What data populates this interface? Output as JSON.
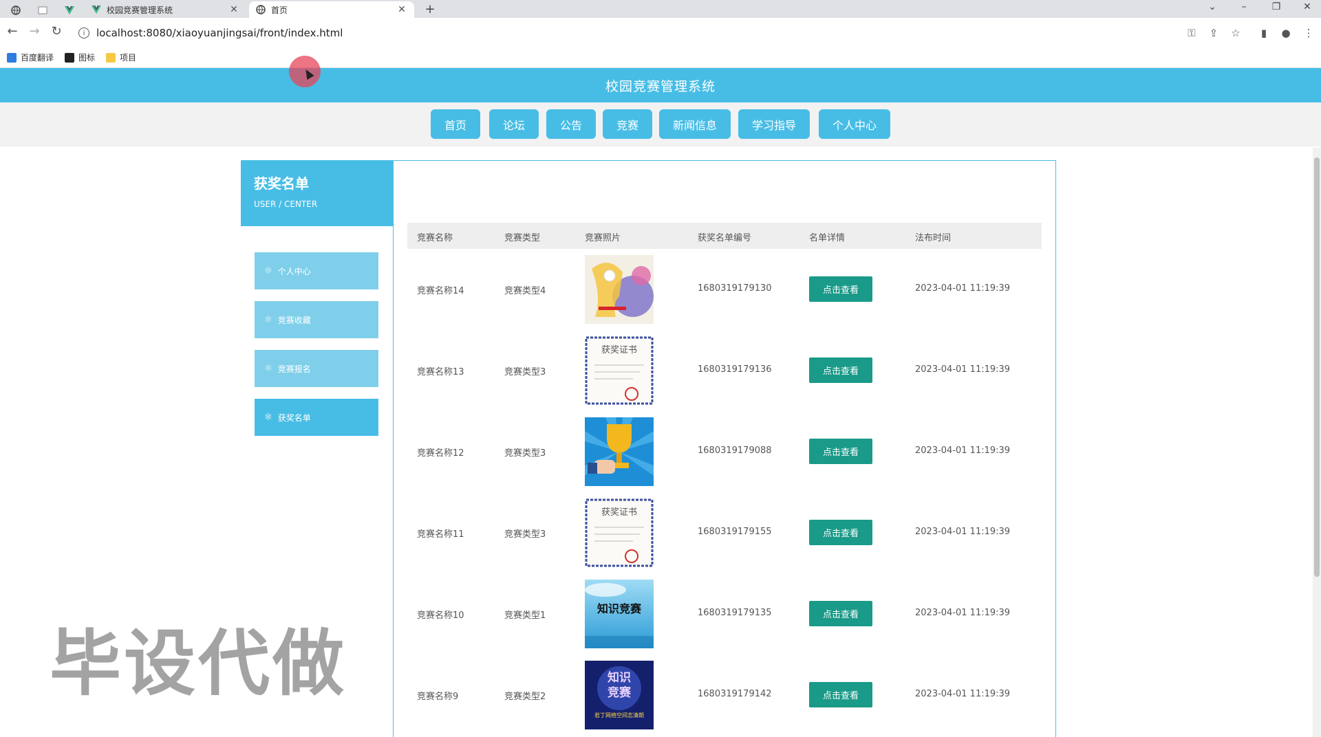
{
  "browser": {
    "tabs": [
      {
        "title": "校园竞赛管理系统",
        "active": false
      },
      {
        "title": "首页",
        "active": true
      }
    ],
    "address": "localhost:8080/xiaoyuanjingsai/front/index.html",
    "bookmarks": [
      "百度翻译",
      "图标",
      "项目"
    ]
  },
  "site": {
    "title": "校园竞赛管理系统",
    "nav": [
      "首页",
      "论坛",
      "公告",
      "竞赛",
      "新闻信息",
      "学习指导",
      "个人中心"
    ]
  },
  "sidebar": {
    "title": "获奖名单",
    "subtitle": "USER / CENTER",
    "items": [
      {
        "label": "个人中心",
        "active": false
      },
      {
        "label": "竞赛收藏",
        "active": false
      },
      {
        "label": "竞赛报名",
        "active": false
      },
      {
        "label": "获奖名单",
        "active": true
      }
    ]
  },
  "table": {
    "headers": [
      "竞赛名称",
      "竞赛类型",
      "竞赛照片",
      "获奖名单编号",
      "名单详情",
      "法布时间"
    ],
    "button_label": "点击查看",
    "rows": [
      {
        "name": "竞赛名称14",
        "type": "竞赛类型4",
        "photo": "abstract-face-image",
        "number": "1680319179130",
        "time": "2023-04-01 11:19:39"
      },
      {
        "name": "竞赛名称13",
        "type": "竞赛类型3",
        "photo": "certificate-image",
        "number": "1680319179136",
        "time": "2023-04-01 11:19:39"
      },
      {
        "name": "竞赛名称12",
        "type": "竞赛类型3",
        "photo": "trophy-image",
        "number": "1680319179088",
        "time": "2023-04-01 11:19:39"
      },
      {
        "name": "竞赛名称11",
        "type": "竞赛类型3",
        "photo": "certificate-image",
        "number": "1680319179155",
        "time": "2023-04-01 11:19:39"
      },
      {
        "name": "竞赛名称10",
        "type": "竞赛类型1",
        "photo": "knowledge-contest-sky-image",
        "number": "1680319179135",
        "time": "2023-04-01 11:19:39"
      },
      {
        "name": "竞赛名称9",
        "type": "竞赛类型2",
        "photo": "knowledge-contest-poster-image",
        "number": "1680319179142",
        "time": "2023-04-01 11:19:39"
      }
    ],
    "photo_text": {
      "certificate": "获奖证书",
      "knowledge_contest": "知识竞赛",
      "poster_top": "知识",
      "poster_mid": "竞赛",
      "poster_bottom": "若丁网络空间志清朗"
    }
  },
  "watermark": "毕设代做",
  "colors": {
    "brand": "#47bde6",
    "button": "#1a9a88",
    "sidebar_item": "#7fcfea"
  }
}
